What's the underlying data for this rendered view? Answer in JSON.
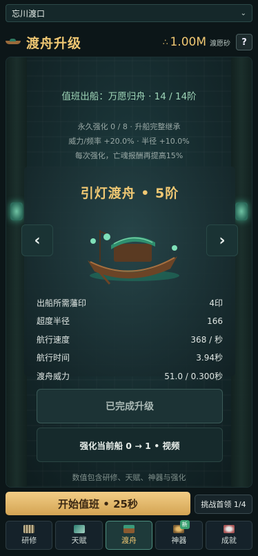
{
  "location": {
    "selected": "忘川渡口"
  },
  "header": {
    "title": "渡舟升级",
    "currency_value": "1.00M",
    "currency_name": "渡愿砂",
    "help_label": "?"
  },
  "duty": {
    "text": "值班出船：万愿归舟 · 14 / 14阶"
  },
  "upgrade_info": {
    "line1": "永久强化 0 / 8 · 升船完整继承",
    "line2": "威力/频率 +20.0% · 半径 +10.0%",
    "line3": "每次强化，亡魂报酬再提高15%"
  },
  "ship": {
    "title": "引灯渡舟 • 5阶",
    "prev_label": "‹",
    "next_label": "›",
    "stats": [
      {
        "label": "出船所需藩印",
        "value": "4印"
      },
      {
        "label": "超度半径",
        "value": "166"
      },
      {
        "label": "航行速度",
        "value": "368 / 秒"
      },
      {
        "label": "航行时间",
        "value": "3.94秒"
      },
      {
        "label": "渡舟威力",
        "value": "51.0 / 0.300秒"
      }
    ]
  },
  "buttons": {
    "done_label": "已完成升级",
    "enhance_label": "强化当前船 0 → 1 • 视频"
  },
  "note": "数值包含研修、天赋、神器与强化",
  "footer": {
    "start_label": "开始值班 • 25秒",
    "challenge_label": "挑战首领 1/4"
  },
  "tabs": [
    {
      "label": "研修",
      "icon": "scroll-icon"
    },
    {
      "label": "天赋",
      "icon": "leaf-icon"
    },
    {
      "label": "渡舟",
      "icon": "boat-icon"
    },
    {
      "label": "神器",
      "icon": "artifact-icon",
      "badge": "新"
    },
    {
      "label": "成就",
      "icon": "medal-icon"
    }
  ],
  "colors": {
    "accent_gold": "#f0c873",
    "teal_text": "#9fd6b8",
    "badge_green": "#3aa071"
  }
}
